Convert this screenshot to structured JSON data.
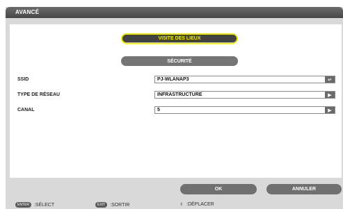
{
  "window": {
    "title": "AVANCÉ"
  },
  "tabs": {
    "site_survey": "VISITE DES LIEUX",
    "security": "SÉCURITÉ"
  },
  "fields": {
    "ssid": {
      "label": "SSID",
      "value": "PJ-WLANAP3",
      "icon": "enter-icon"
    },
    "network_type": {
      "label": "TYPE DE RÉSEAU",
      "value": "INFRASTRUCTURE",
      "icon": "right-arrow-icon"
    },
    "channel": {
      "label": "CANAL",
      "value": "5",
      "icon": "right-arrow-icon"
    }
  },
  "actions": {
    "ok": "OK",
    "cancel": "ANNULER"
  },
  "hints": {
    "enter_key": "ENTER",
    "enter_text": ":SÉLECT",
    "exit_key": "EXIT",
    "exit_text": ":SORTIR",
    "move_text": ":DÉPLACER"
  },
  "colors": {
    "active_border": "#e8e800",
    "button_bg": "#707070",
    "titlebar_bg": "#474747"
  }
}
